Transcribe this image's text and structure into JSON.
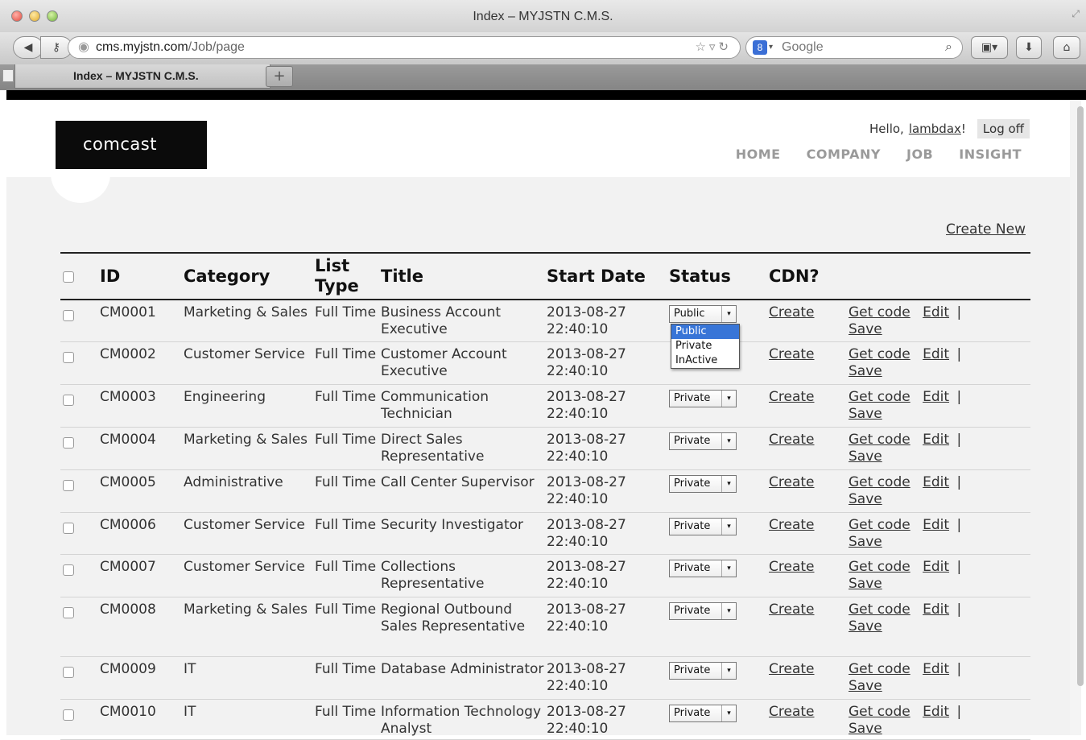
{
  "browser": {
    "window_title": "Index – MYJSTN C.M.S.",
    "url_host": "cms.myjstn.com",
    "url_prefix": "",
    "url_path": "/Job/page",
    "search_placeholder": "Google",
    "tab_title": "Index – MYJSTN C.M.S.",
    "new_tab": "+"
  },
  "header": {
    "logo_text": "comcast",
    "greeting": "Hello,",
    "username": "lambdax",
    "greeting_suffix": "!",
    "logoff": "Log off",
    "nav": [
      "HOME",
      "COMPANY",
      "JOB",
      "INSIGHT"
    ]
  },
  "content": {
    "create_new": "Create New",
    "columns": {
      "id": "ID",
      "category": "Category",
      "list_type_1": "List",
      "list_type_2": "Type",
      "title": "Title",
      "start_date": "Start Date",
      "status": "Status",
      "cdn": "CDN?"
    },
    "rows": [
      {
        "id": "CM0001",
        "category": "Marketing & Sales",
        "list_type": "Full Time",
        "title": "Business Account Executive",
        "date": "2013-08-27",
        "time": "22:40:10",
        "status": "Public",
        "cdn": "Create",
        "get_code": "Get code",
        "edit": "Edit",
        "save": "Save",
        "sep": "|"
      },
      {
        "id": "CM0002",
        "category": "Customer Service",
        "list_type": "Full Time",
        "title": "Customer Account Executive",
        "date": "2013-08-27",
        "time": "22:40:10",
        "status": "",
        "cdn": "Create",
        "get_code": "Get code",
        "edit": "Edit",
        "save": "Save",
        "sep": "|"
      },
      {
        "id": "CM0003",
        "category": "Engineering",
        "list_type": "Full Time",
        "title": "Communication Technician",
        "date": "2013-08-27",
        "time": "22:40:10",
        "status": "Private",
        "cdn": "Create",
        "get_code": "Get code",
        "edit": "Edit",
        "save": "Save",
        "sep": "|"
      },
      {
        "id": "CM0004",
        "category": "Marketing & Sales",
        "list_type": "Full Time",
        "title": "Direct Sales Representative",
        "date": "2013-08-27",
        "time": "22:40:10",
        "status": "Private",
        "cdn": "Create",
        "get_code": "Get code",
        "edit": "Edit",
        "save": "Save",
        "sep": "|"
      },
      {
        "id": "CM0005",
        "category": "Administrative",
        "list_type": "Full Time",
        "title": "Call Center Supervisor",
        "date": "2013-08-27",
        "time": "22:40:10",
        "status": "Private",
        "cdn": "Create",
        "get_code": "Get code",
        "edit": "Edit",
        "save": "Save",
        "sep": "|"
      },
      {
        "id": "CM0006",
        "category": "Customer Service",
        "list_type": "Full Time",
        "title": "Security Investigator",
        "date": "2013-08-27",
        "time": "22:40:10",
        "status": "Private",
        "cdn": "Create",
        "get_code": "Get code",
        "edit": "Edit",
        "save": "Save",
        "sep": "|"
      },
      {
        "id": "CM0007",
        "category": "Customer Service",
        "list_type": "Full Time",
        "title": "Collections Representative",
        "date": "2013-08-27",
        "time": "22:40:10",
        "status": "Private",
        "cdn": "Create",
        "get_code": "Get code",
        "edit": "Edit",
        "save": "Save",
        "sep": "|"
      },
      {
        "id": "CM0008",
        "category": "Marketing & Sales",
        "list_type": "Full Time",
        "title": "Regional Outbound Sales Representative",
        "date": "2013-08-27",
        "time": "22:40:10",
        "status": "Private",
        "cdn": "Create",
        "get_code": "Get code",
        "edit": "Edit",
        "save": "Save",
        "sep": "|"
      },
      {
        "id": "CM0009",
        "category": "IT",
        "list_type": "Full Time",
        "title": "Database Administrator",
        "date": "2013-08-27",
        "time": "22:40:10",
        "status": "Private",
        "cdn": "Create",
        "get_code": "Get code",
        "edit": "Edit",
        "save": "Save",
        "sep": "|"
      },
      {
        "id": "CM0010",
        "category": "IT",
        "list_type": "Full Time",
        "title": "Information Technology Analyst",
        "date": "2013-08-27",
        "time": "22:40:10",
        "status": "Private",
        "cdn": "Create",
        "get_code": "Get code",
        "edit": "Edit",
        "save": "Save",
        "sep": "|"
      }
    ],
    "status_dropdown": {
      "options": [
        "Public",
        "Private",
        "InActive"
      ],
      "highlighted": "Public"
    }
  },
  "icons": {
    "back": "back-arrow-icon",
    "site": "site-identity-icon",
    "bookmark": "bookmark-star-icon",
    "reload": "reload-icon",
    "search": "magnifier-icon",
    "download": "download-icon",
    "home": "home-icon"
  }
}
